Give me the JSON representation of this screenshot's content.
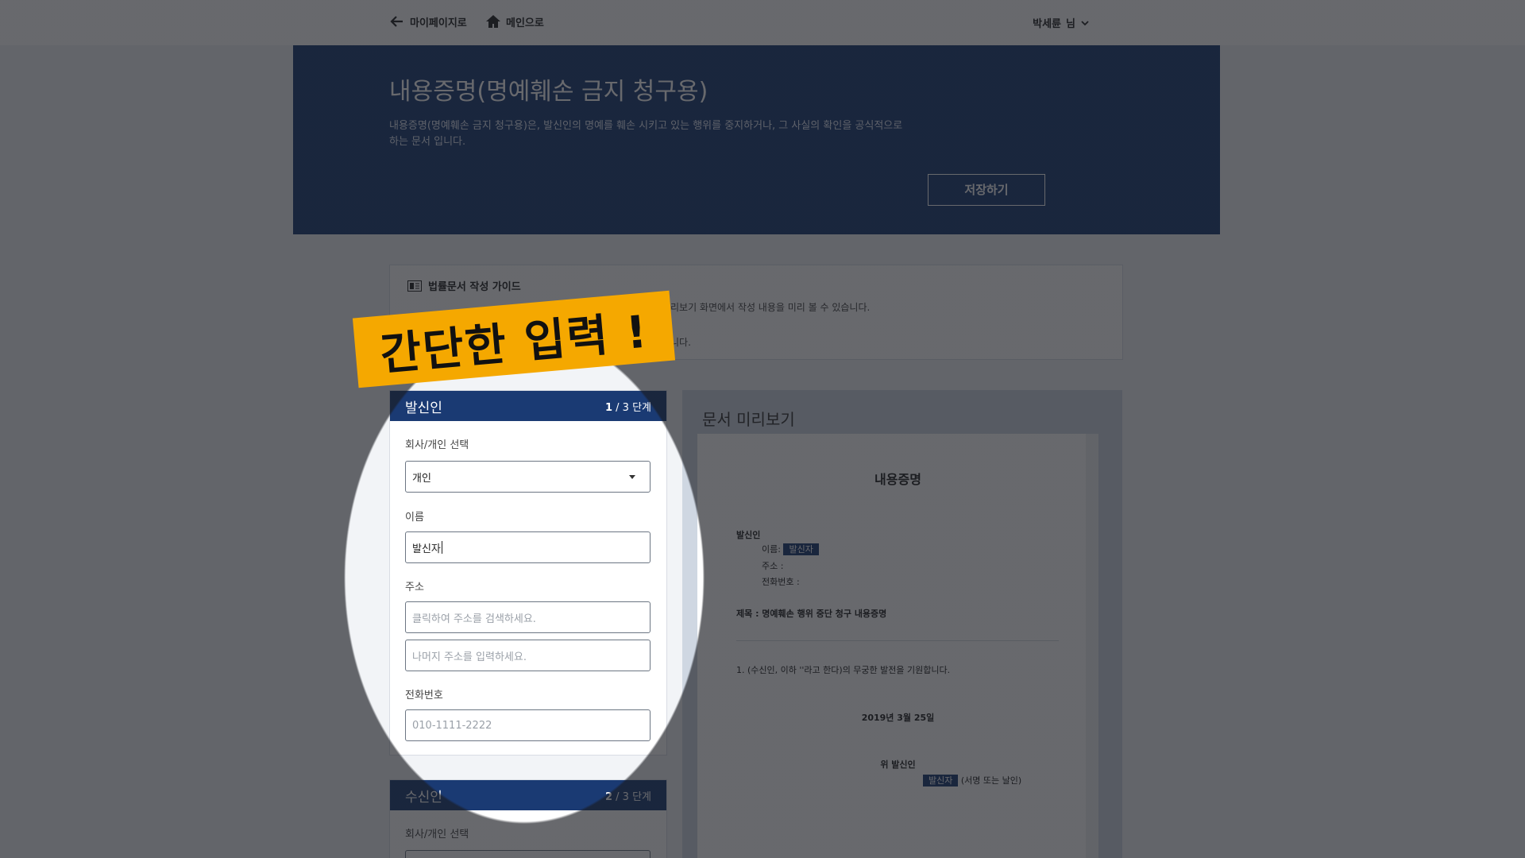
{
  "topbar": {
    "back_label": "마이페이지로",
    "home_label": "메인으로",
    "user_name": "박세륜",
    "user_suffix": "님"
  },
  "hero": {
    "title": "내용증명(명예훼손 금지 청구용)",
    "description": "내용증명(명예훼손 금지 청구용)은, 발신인의 명예를 훼손 시키고 있는 행위를 중지하거나, 그 사실의 확인을 공식적으로 하는 문서 입니다.",
    "save_label": "저장하기"
  },
  "guide": {
    "title": "법률문서 작성 가이드",
    "line1_visible": "리보기 화면에서 작성 내용을 미리 볼 수 있습니다.",
    "line2_visible": "니다."
  },
  "promo": {
    "text": "간단한 입력 !"
  },
  "form": {
    "sender": {
      "name": "발신인",
      "step_current": "1",
      "step_total": " / 3 단계",
      "type_label": "회사/개인 선택",
      "type_value": "개인",
      "name_label": "이름",
      "name_value": "발신자",
      "address_label": "주소",
      "address_placeholder": "클릭하여 주소를 검색하세요.",
      "address_detail_placeholder": "나머지 주소를 입력하세요.",
      "phone_label": "전화번호",
      "phone_placeholder": "010-1111-2222"
    },
    "receiver": {
      "name": "수신인",
      "step_current": "2",
      "step_total": " / 3 단계",
      "type_label": "회사/개인 선택"
    }
  },
  "preview": {
    "heading": "문서 미리보기",
    "doc_title": "내용증명",
    "sender_heading": "발신인",
    "name_label": "이름:",
    "name_value": "발신자",
    "address_label": "주소 :",
    "phone_label": "전화번호 :",
    "subject": "제목 : 명예훼손 행위 중단 청구 내용증명",
    "body_line1": "1. (수신인, 이하 ''라고 한다)의 무궁한 발전을 기원합니다.",
    "date": "2019년 3월 25일",
    "closing": "위 발신인",
    "signer": "발신자",
    "sign_note": "(서명 또는 날인)"
  }
}
